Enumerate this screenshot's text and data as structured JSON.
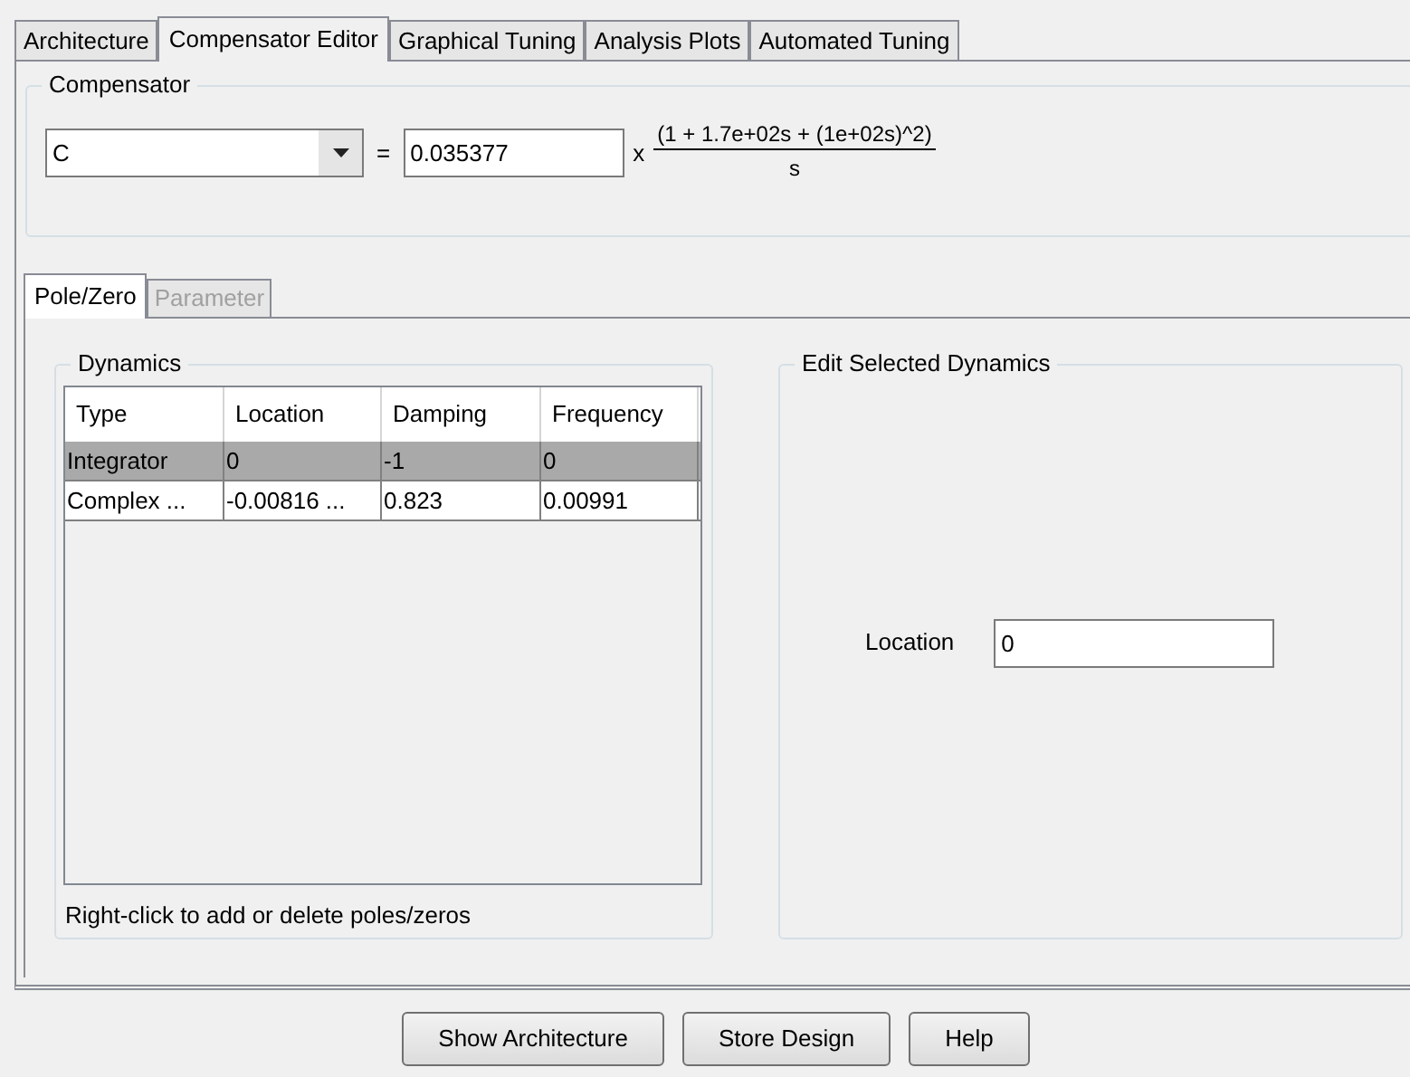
{
  "tabs": [
    {
      "label": "Architecture",
      "selected": false
    },
    {
      "label": "Compensator Editor",
      "selected": true
    },
    {
      "label": "Graphical Tuning",
      "selected": false
    },
    {
      "label": "Analysis Plots",
      "selected": false
    },
    {
      "label": "Automated Tuning",
      "selected": false
    }
  ],
  "compensator": {
    "title": "Compensator",
    "name": "C",
    "equals": "=",
    "gain": "0.035377",
    "times": "x",
    "numerator": "(1 + 1.7e+02s + (1e+02s)^2)",
    "denominator": "s"
  },
  "sub_tabs": [
    {
      "label": "Pole/Zero",
      "selected": true,
      "disabled": false
    },
    {
      "label": "Parameter",
      "selected": false,
      "disabled": true
    }
  ],
  "dynamics": {
    "title": "Dynamics",
    "columns": [
      "Type",
      "Location",
      "Damping",
      "Frequency"
    ],
    "rows": [
      {
        "cells": [
          "Integrator",
          "0",
          "-1",
          "0"
        ],
        "selected": true
      },
      {
        "cells": [
          "Complex ...",
          "-0.00816 ...",
          "0.823",
          "0.00991"
        ],
        "selected": false
      }
    ],
    "hint": "Right-click to add or delete poles/zeros"
  },
  "edit": {
    "title": "Edit Selected Dynamics",
    "field_label": "Location",
    "field_value": "0"
  },
  "buttons": [
    "Show Architecture",
    "Store Design",
    "Help"
  ]
}
